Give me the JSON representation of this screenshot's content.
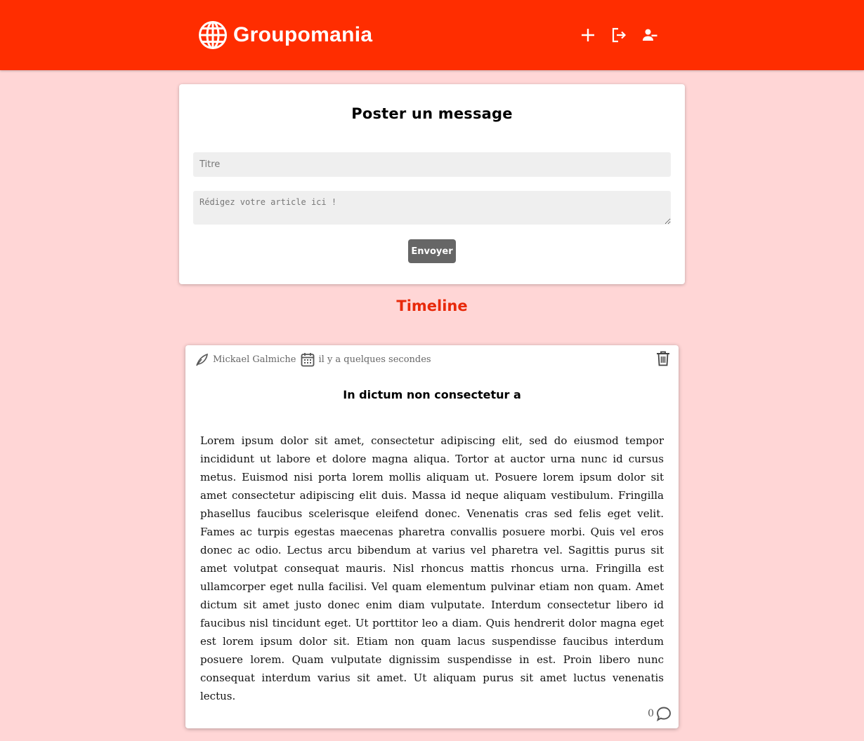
{
  "header": {
    "brand": "Groupomania",
    "actions": [
      {
        "name": "new-post",
        "icon": "plus-icon"
      },
      {
        "name": "logout",
        "icon": "logout-icon"
      },
      {
        "name": "remove-account",
        "icon": "person-remove-icon"
      }
    ]
  },
  "composer": {
    "heading": "Poster un message",
    "title_placeholder": "Titre",
    "title_value": "",
    "body_placeholder": "Rédigez votre article ici !",
    "body_value": "",
    "submit_label": "Envoyer"
  },
  "timeline": {
    "heading": "Timeline"
  },
  "posts": [
    {
      "author": "Mickael Galmiche",
      "date": "il y a quelques secondes",
      "title": "In dictum non consectetur a",
      "body": "Lorem ipsum dolor sit amet, consectetur adipiscing elit, sed do eiusmod tempor incididunt ut labore et dolore magna aliqua. Tortor at auctor urna nunc id cursus metus. Euismod nisi porta lorem mollis aliquam ut. Posuere lorem ipsum dolor sit amet consectetur adipiscing elit duis. Massa id neque aliquam vestibulum. Fringilla phasellus faucibus scelerisque eleifend donec. Venenatis cras sed felis eget velit. Fames ac turpis egestas maecenas pharetra convallis posuere morbi. Quis vel eros donec ac odio. Lectus arcu bibendum at varius vel pharetra vel. Sagittis purus sit amet volutpat consequat mauris. Nisl rhoncus mattis rhoncus urna. Fringilla est ullamcorper eget nulla facilisi. Vel quam elementum pulvinar etiam non quam. Amet dictum sit amet justo donec enim diam vulputate. Interdum consectetur libero id faucibus nisl tincidunt eget. Ut porttitor leo a diam. Quis hendrerit dolor magna eget est lorem ipsum dolor sit. Etiam non quam lacus suspendisse faucibus interdum posuere lorem. Quam vulputate dignissim suspendisse in est. Proin libero nunc consequat interdum varius sit amet. Ut aliquam purus sit amet luctus venenatis lectus.",
      "comment_count": "0"
    }
  ],
  "colors": {
    "header_bg": "#ff2d00",
    "page_bg": "#ffd6d6",
    "accent_text": "#e8290a",
    "button_bg": "#666666"
  }
}
